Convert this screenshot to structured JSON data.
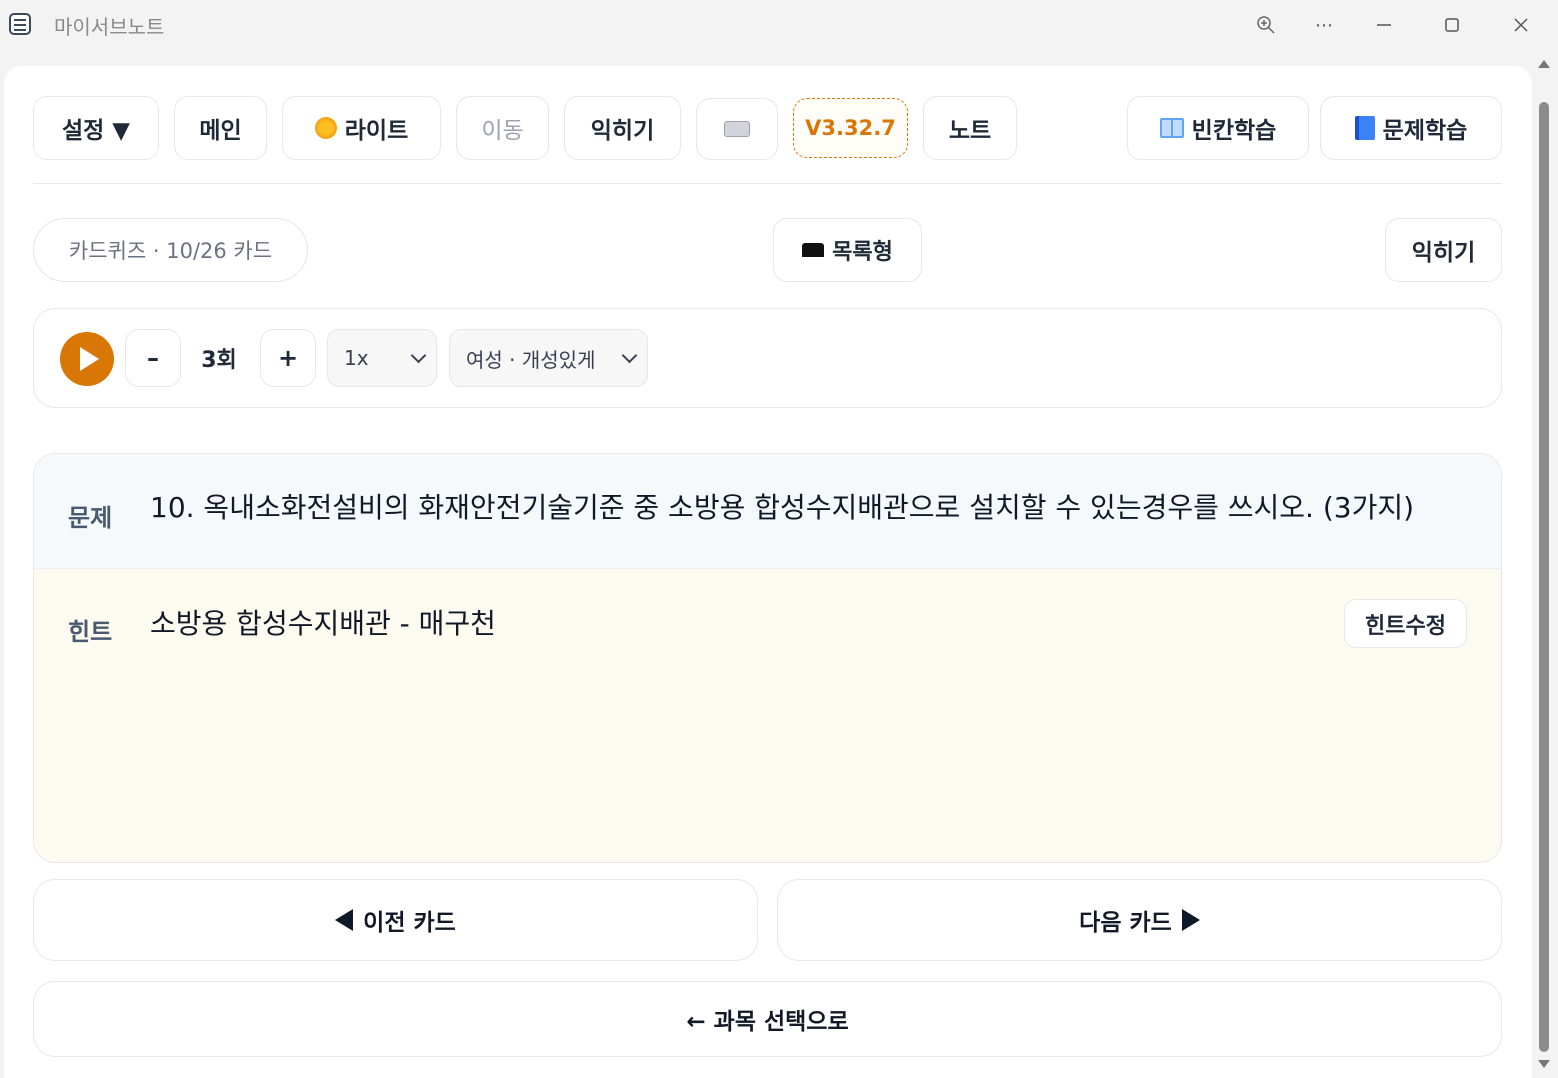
{
  "window": {
    "title": "마이서브노트"
  },
  "toolbar": {
    "settings": "설정 ▼",
    "main": "메인",
    "theme": "라이트",
    "move": "이동",
    "memorize": "익히기",
    "version": "V3.32.7",
    "note": "노트",
    "blank_study": "빈칸학습",
    "problem_study": "문제학습"
  },
  "quiz": {
    "status": "카드퀴즈 · 10/26 카드",
    "list_view": "목록형",
    "memorize": "익히기"
  },
  "audio": {
    "minus": "–",
    "count": "3회",
    "plus": "+",
    "speed": "1x",
    "voice": "여성 · 개성있게"
  },
  "card": {
    "question_label": "문제",
    "question": "10. 옥내소화전설비의 화재안전기술기준 중 소방용 합성수지배관으로 설치할 수 있는경우를 쓰시오. (3가지)",
    "hint_label": "힌트",
    "hint": "소방용 합성수지배관 - 매구천",
    "hint_edit": "힌트수정"
  },
  "nav": {
    "prev": "이전 카드",
    "next": "다음 카드",
    "back": "← 과목 선택으로"
  },
  "colors": {
    "accent": "#d97706",
    "question_bg": "#f6f9fc",
    "hint_bg": "#fdfbf0"
  }
}
